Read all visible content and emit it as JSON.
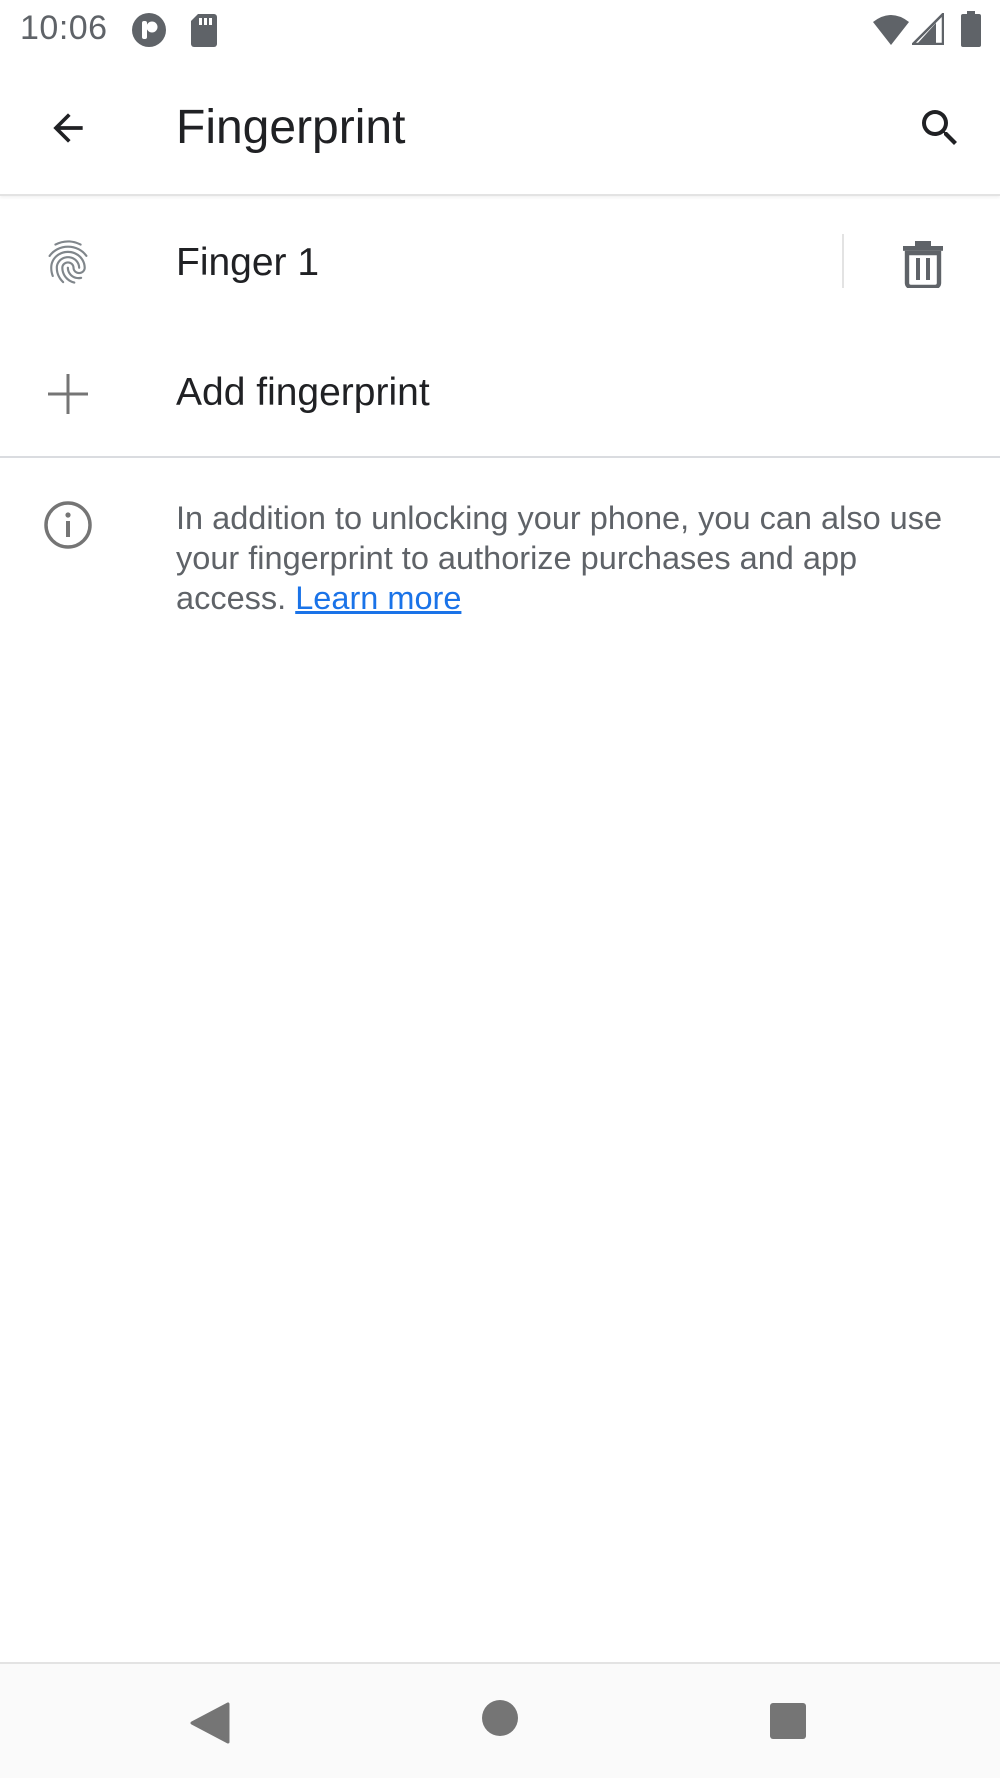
{
  "status_bar": {
    "time": "10:06"
  },
  "app_bar": {
    "title": "Fingerprint",
    "back_icon": "arrow-back-icon",
    "search_icon": "search-icon"
  },
  "fingerprints": [
    {
      "label": "Finger 1",
      "icon": "fingerprint-icon",
      "action_icon": "delete-icon"
    }
  ],
  "add_fingerprint": {
    "label": "Add fingerprint",
    "icon": "plus-icon"
  },
  "info": {
    "icon": "info-icon",
    "text": "In addition to unlocking your phone, you can also use your fingerprint to authorize purchases and app access.",
    "link_text": "Learn more",
    "link_color": "#1a73e8"
  },
  "nav_bar": {
    "back_icon": "nav-back-icon",
    "home_icon": "nav-home-icon",
    "recents_icon": "nav-recents-icon"
  }
}
